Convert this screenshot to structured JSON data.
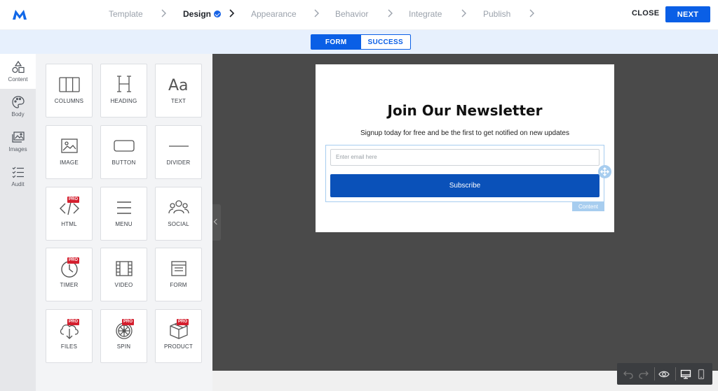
{
  "header": {
    "steps": [
      {
        "label": "Template",
        "state": "upcoming"
      },
      {
        "label": "Design",
        "state": "active"
      },
      {
        "label": "Appearance",
        "state": "upcoming"
      },
      {
        "label": "Behavior",
        "state": "upcoming"
      },
      {
        "label": "Integrate",
        "state": "upcoming"
      },
      {
        "label": "Publish",
        "state": "upcoming"
      }
    ],
    "close_label": "CLOSE",
    "next_label": "NEXT"
  },
  "mode_toggle": {
    "form_label": "FORM",
    "success_label": "SUCCESS",
    "selected": "FORM"
  },
  "rail": {
    "items": [
      {
        "label": "Content",
        "icon": "shapes-icon",
        "active": true
      },
      {
        "label": "Body",
        "icon": "palette-icon",
        "active": false
      },
      {
        "label": "Images",
        "icon": "images-icon",
        "active": false
      },
      {
        "label": "Audit",
        "icon": "checklist-icon",
        "active": false
      }
    ]
  },
  "blocks": [
    {
      "label": "COLUMNS",
      "icon": "columns-icon",
      "pro": false
    },
    {
      "label": "HEADING",
      "icon": "heading-icon",
      "pro": false
    },
    {
      "label": "TEXT",
      "icon": "text-icon",
      "pro": false
    },
    {
      "label": "IMAGE",
      "icon": "image-icon",
      "pro": false
    },
    {
      "label": "BUTTON",
      "icon": "button-icon",
      "pro": false
    },
    {
      "label": "DIVIDER",
      "icon": "divider-icon",
      "pro": false
    },
    {
      "label": "HTML",
      "icon": "code-icon",
      "pro": true
    },
    {
      "label": "MENU",
      "icon": "menu-icon",
      "pro": false
    },
    {
      "label": "SOCIAL",
      "icon": "social-icon",
      "pro": false
    },
    {
      "label": "TIMER",
      "icon": "timer-icon",
      "pro": true
    },
    {
      "label": "VIDEO",
      "icon": "video-icon",
      "pro": false
    },
    {
      "label": "FORM",
      "icon": "form-icon",
      "pro": false
    },
    {
      "label": "FILES",
      "icon": "files-icon",
      "pro": true
    },
    {
      "label": "SPIN",
      "icon": "spin-wheel-icon",
      "pro": true
    },
    {
      "label": "PRODUCT",
      "icon": "product-icon",
      "pro": true
    }
  ],
  "pro_badge": "PRO",
  "popup": {
    "title": "Join Our Newsletter",
    "subtitle": "Signup today for free and be the first to get notified on new updates",
    "email_placeholder": "Enter email here",
    "button_label": "Subscribe",
    "selection_tag": "Content"
  },
  "colors": {
    "accent": "#0a5fe6",
    "subscribe_button": "#0a51b9",
    "canvas": "#4a4a4a",
    "selection": "#a7cdef",
    "pro_badge": "#d41f2e"
  }
}
